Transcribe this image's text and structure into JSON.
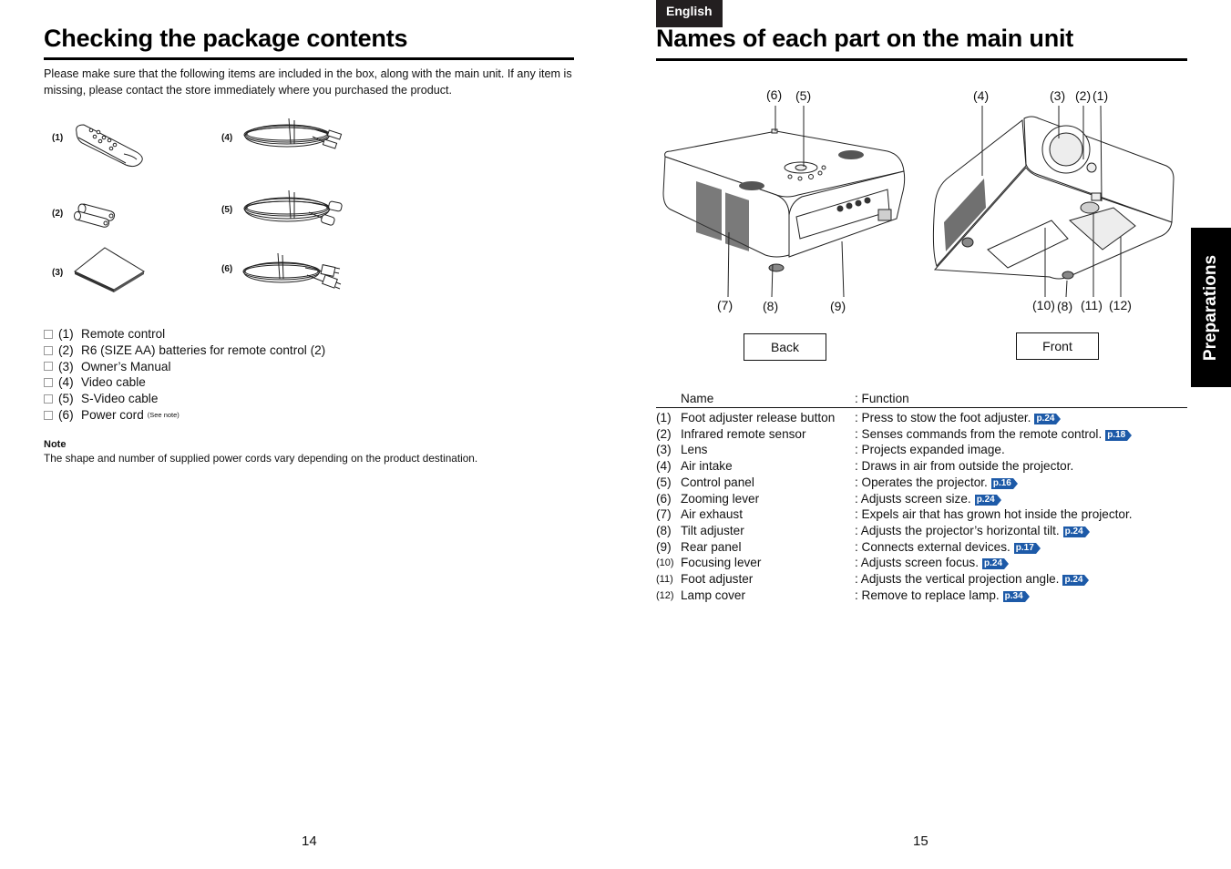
{
  "left_page": {
    "title": "Checking the package contents",
    "intro": "Please make sure that the following items are included in the box, along with the main unit. If any item is missing, please contact the store immediately where you purchased the product.",
    "illustrations": [
      {
        "label": "(1)",
        "icon": "remote-control-icon"
      },
      {
        "label": "(2)",
        "icon": "batteries-icon"
      },
      {
        "label": "(3)",
        "icon": "manual-icon"
      },
      {
        "label": "(4)",
        "icon": "video-cable-icon"
      },
      {
        "label": "(5)",
        "icon": "s-video-cable-icon"
      },
      {
        "label": "(6)",
        "icon": "power-cord-icon"
      }
    ],
    "checklist": [
      {
        "num": "(1)",
        "text": "Remote control",
        "note": ""
      },
      {
        "num": "(2)",
        "text": "R6 (SIZE AA) batteries for remote control (2)",
        "note": ""
      },
      {
        "num": "(3)",
        "text": "Owner’s Manual",
        "note": ""
      },
      {
        "num": "(4)",
        "text": "Video cable",
        "note": ""
      },
      {
        "num": "(5)",
        "text": "S-Video cable",
        "note": ""
      },
      {
        "num": "(6)",
        "text": "Power cord",
        "note": "(See note)"
      }
    ],
    "note_title": "Note",
    "note_text": "The shape and number of supplied power cords vary depending on the product destination.",
    "page_number": "14"
  },
  "right_page": {
    "language_badge": "English",
    "title": "Names of each part on the main unit",
    "back_callouts": [
      "(6)",
      "(5)",
      "(7)",
      "(8)",
      "(9)"
    ],
    "front_callouts": [
      "(4)",
      "(3)",
      "(2)",
      "(1)",
      "(10)",
      "(8)",
      "(11)",
      "(12)"
    ],
    "back_label": "Back",
    "front_label": "Front",
    "table_header": {
      "name": "Name",
      "function": ": Function"
    },
    "parts": [
      {
        "num": "(1)",
        "name": "Foot adjuster release button",
        "function": ": Press to stow the foot adjuster.",
        "ref": "p.24"
      },
      {
        "num": "(2)",
        "name": "Infrared remote sensor",
        "function": ": Senses commands from the remote control.",
        "ref": "p.18"
      },
      {
        "num": "(3)",
        "name": "Lens",
        "function": ": Projects expanded image.",
        "ref": ""
      },
      {
        "num": "(4)",
        "name": "Air intake",
        "function": ": Draws in air from outside the projector.",
        "ref": ""
      },
      {
        "num": "(5)",
        "name": "Control panel",
        "function": ": Operates the projector.",
        "ref": "p.16"
      },
      {
        "num": "(6)",
        "name": "Zooming lever",
        "function": ": Adjusts screen size.",
        "ref": "p.24"
      },
      {
        "num": "(7)",
        "name": "Air exhaust",
        "function": ": Expels air that has grown hot inside the projector.",
        "ref": ""
      },
      {
        "num": "(8)",
        "name": "Tilt adjuster",
        "function": ": Adjusts the projector’s horizontal tilt.",
        "ref": "p.24"
      },
      {
        "num": "(9)",
        "name": "Rear panel",
        "function": ": Connects external devices.",
        "ref": "p.17"
      },
      {
        "num": "(10)",
        "name": "Focusing lever",
        "function": ": Adjusts screen focus.",
        "ref": "p.24"
      },
      {
        "num": "(11)",
        "name": "Foot adjuster",
        "function": ": Adjusts the vertical projection angle.",
        "ref": "p.24"
      },
      {
        "num": "(12)",
        "name": "Lamp cover",
        "function": ": Remove to replace lamp.",
        "ref": "p.34"
      }
    ],
    "side_tab": "Preparations",
    "page_number": "15"
  }
}
